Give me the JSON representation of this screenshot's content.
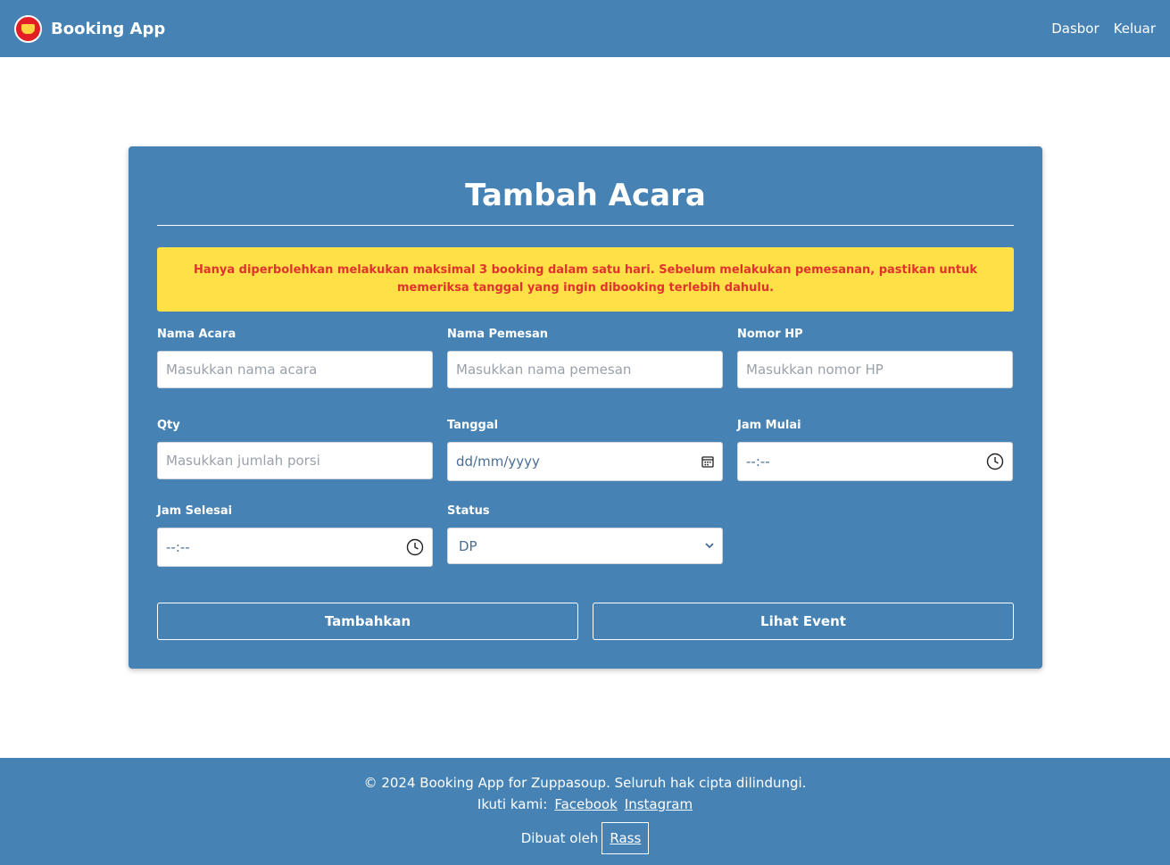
{
  "navbar": {
    "brand": "Booking App",
    "links": [
      "Dasbor",
      "Keluar"
    ]
  },
  "form": {
    "title": "Tambah Acara",
    "alert": "Hanya diperbolehkan melakukan maksimal 3 booking dalam satu hari. Sebelum melakukan pemesanan, pastikan untuk memeriksa tanggal yang ingin dibooking terlebih dahulu.",
    "fields": {
      "nama_acara": {
        "label": "Nama Acara",
        "placeholder": "Masukkan nama acara"
      },
      "nama_pemesan": {
        "label": "Nama Pemesan",
        "placeholder": "Masukkan nama pemesan"
      },
      "nomor_hp": {
        "label": "Nomor HP",
        "placeholder": "Masukkan nomor HP"
      },
      "qty": {
        "label": "Qty",
        "placeholder": "Masukkan jumlah porsi"
      },
      "tanggal": {
        "label": "Tanggal",
        "value": "dd/mm/yyyy"
      },
      "jam_mulai": {
        "label": "Jam Mulai",
        "value": "--:--"
      },
      "jam_selesai": {
        "label": "Jam Selesai",
        "value": "--:--"
      },
      "status": {
        "label": "Status",
        "value": "DP"
      }
    },
    "buttons": {
      "submit": "Tambahkan",
      "view": "Lihat Event"
    }
  },
  "footer": {
    "copyright": "© 2024 Booking App for Zuppasoup. Seluruh hak cipta dilindungi.",
    "follow_label": "Ikuti kami:",
    "social": [
      "Facebook",
      "Instagram"
    ],
    "made_by_label": "Dibuat oleh",
    "author": "Rass"
  },
  "colors": {
    "primary": "#4682b4",
    "alert_bg": "#ffe047",
    "alert_text": "#e0332d"
  },
  "icons": {
    "logo": "brand-logo",
    "calendar": "calendar-icon",
    "clock": "clock-icon",
    "chevron": "chevron-down-icon"
  }
}
